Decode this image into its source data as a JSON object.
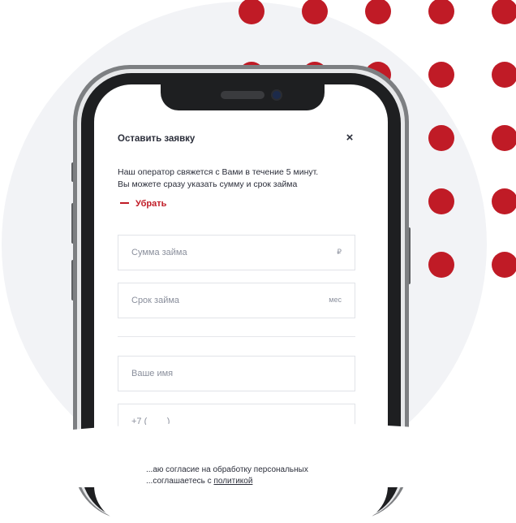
{
  "form": {
    "title": "Оставить заявку",
    "close_symbol": "×",
    "description_line1": "Наш оператор свяжется с Вами в течение 5 минут.",
    "description_line2": "Вы можете сразу указать сумму и срок займа",
    "remove_label": "Убрать",
    "amount_placeholder": "Сумма займа",
    "amount_suffix": "₽",
    "term_placeholder": "Срок займа",
    "term_suffix": "мес",
    "name_placeholder": "Ваше имя",
    "phone_placeholder": "+7 (_ _ _) _ _ _  _ _  _ _",
    "consent_line1": "...аю согласие на обработку персональных",
    "consent_line2_prefix": "...соглашаетесь с ",
    "consent_policy": "политикой"
  },
  "colors": {
    "accent": "#c01b26",
    "background_circle": "#f2f3f6",
    "text": "#2b2e3a"
  }
}
